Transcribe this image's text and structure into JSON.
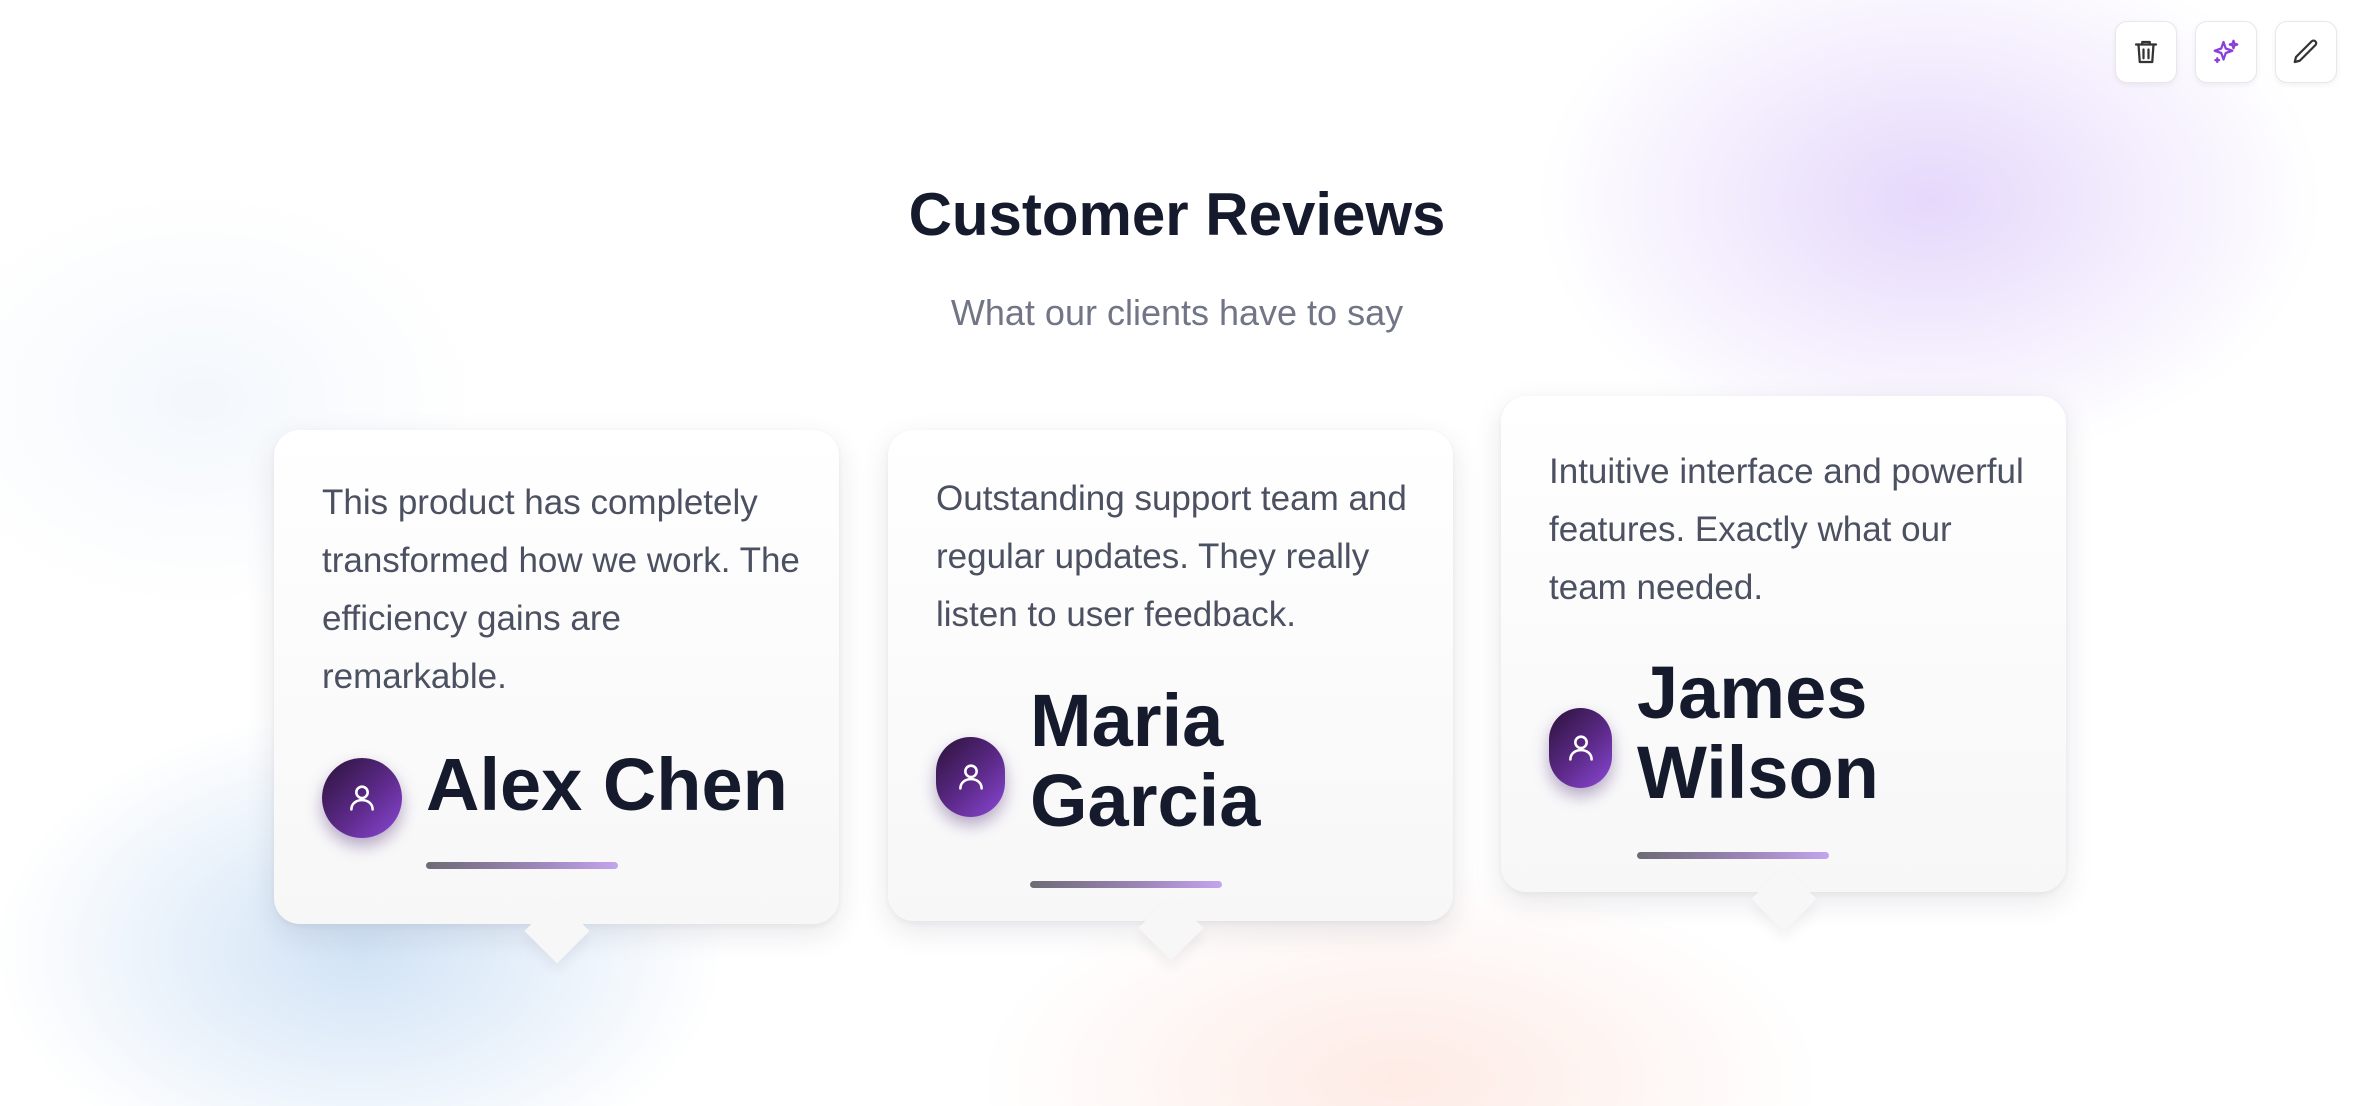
{
  "header": {
    "title": "Customer Reviews",
    "subtitle": "What our clients have to say"
  },
  "toolbar": {
    "buttons": [
      {
        "name": "delete",
        "icon": "trash-icon",
        "color": "#333333"
      },
      {
        "name": "ai-generate",
        "icon": "sparkles-icon",
        "color": "#8b3fd9"
      },
      {
        "name": "edit",
        "icon": "pencil-icon",
        "color": "#333333"
      }
    ]
  },
  "reviews": [
    {
      "quote": "This product has completely transformed how we work. The efficiency gains are remarkable.",
      "name": "Alex Chen",
      "avatar_icon": "user-icon"
    },
    {
      "quote": "Outstanding support team and regular updates. They really listen to user feedback.",
      "name": "Maria Garcia",
      "avatar_icon": "user-icon"
    },
    {
      "quote": "Intuitive interface and powerful features. Exactly what our team needed.",
      "name": "James Wilson",
      "avatar_icon": "user-icon"
    }
  ],
  "colors": {
    "title": "#151a2c",
    "subtitle": "#717585",
    "quote": "#4b5161",
    "accent": "#8a48d6",
    "avatar_dark": "#2a1238"
  }
}
